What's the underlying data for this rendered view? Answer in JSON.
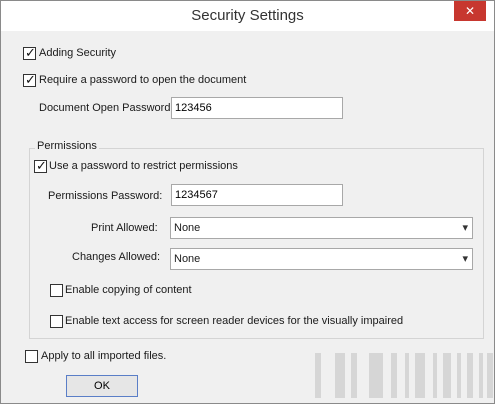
{
  "window": {
    "title": "Security Settings",
    "close_glyph": "✕"
  },
  "security": {
    "adding_security": {
      "label": "Adding Security",
      "checked": true
    },
    "require_password": {
      "label": "Require a password to open the document",
      "checked": true
    },
    "open_password": {
      "label": "Document Open Password:",
      "value": "123456"
    }
  },
  "permissions": {
    "group_title": "Permissions",
    "use_password": {
      "label": "Use a password to restrict permissions",
      "checked": true
    },
    "perm_password": {
      "label": "Permissions Password:",
      "value": "1234567"
    },
    "print_allowed": {
      "label": "Print Allowed:",
      "value": "None"
    },
    "changes_allowed": {
      "label": "Changes Allowed:",
      "value": "None"
    },
    "enable_copying": {
      "label": "Enable copying of content",
      "checked": false
    },
    "enable_text_access": {
      "label": "Enable text access for screen reader devices for the visually impaired",
      "checked": false
    }
  },
  "apply_all": {
    "label": "Apply to all imported files.",
    "checked": false
  },
  "ok_button": {
    "label": "OK"
  },
  "icons": {
    "check": "check-icon",
    "dropdown": "chevron-down-icon",
    "close": "close-icon"
  }
}
